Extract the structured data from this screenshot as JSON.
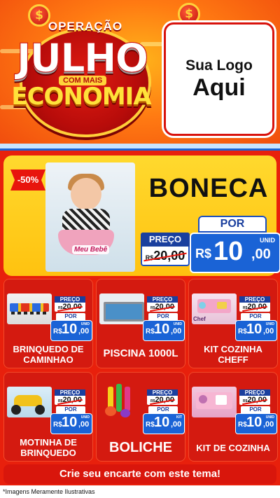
{
  "header": {
    "coin_symbol": "$",
    "title_line1": "OPERAÇÃO",
    "title_line2": "JULHO",
    "title_badge": "COM MAIS",
    "title_line3": "ECONOMIA",
    "logo_line1": "Sua Logo",
    "logo_line2": "Aqui"
  },
  "colors": {
    "background": "#e8200c",
    "price_blue": "#1a63d6",
    "label_navy": "#1a3f9e",
    "main_yellow": "#ffcf1f"
  },
  "featured": {
    "discount": "-50%",
    "name": "BONECA",
    "image_label": "Meu Bebê",
    "preco_label": "PREÇO",
    "old_currency": "R$",
    "old_price": "20,00",
    "por_label": "POR",
    "currency": "R$",
    "price_int": "10",
    "price_dec": ",00",
    "unit": "UNID"
  },
  "products": [
    {
      "name": "BRINQUEDO DE CAMINHAO",
      "preco_label": "PREÇO",
      "old_currency": "R$",
      "old_price": "20,00",
      "por_label": "POR",
      "currency": "R$",
      "price_int": "10",
      "price_dec": ",00",
      "unit": "UNID",
      "icon": "toy-trucks-icon"
    },
    {
      "name": "PISCINA 1000L",
      "preco_label": "PREÇO",
      "old_currency": "R$",
      "old_price": "20,00",
      "por_label": "POR",
      "currency": "R$",
      "price_int": "10",
      "price_dec": ",00",
      "unit": "UNID",
      "icon": "pool-icon"
    },
    {
      "name": "KIT COZINHA CHEFF",
      "preco_label": "PREÇO",
      "old_currency": "R$",
      "old_price": "20,00",
      "por_label": "POR",
      "currency": "R$",
      "price_int": "10",
      "price_dec": ",00",
      "unit": "UNID",
      "icon": "kitchen-toy-icon",
      "image_label": "Chef"
    },
    {
      "name": "MOTINHA DE BRINQUEDO",
      "preco_label": "PREÇO",
      "old_currency": "R$",
      "old_price": "20,00",
      "por_label": "POR",
      "currency": "R$",
      "price_int": "10",
      "price_dec": ",00",
      "unit": "UNID",
      "icon": "toy-motorcycle-icon"
    },
    {
      "name": "BOLICHE",
      "preco_label": "PREÇO",
      "old_currency": "R$",
      "old_price": "20,00",
      "por_label": "POR",
      "currency": "R$",
      "price_int": "10",
      "price_dec": ",00",
      "unit": "KIT",
      "icon": "bowling-pins-icon"
    },
    {
      "name": "KIT DE COZINHA",
      "preco_label": "PREÇO",
      "old_currency": "R$",
      "old_price": "20,00",
      "por_label": "POR",
      "currency": "R$",
      "price_int": "10",
      "price_dec": ",00",
      "unit": "UNID",
      "icon": "kitchen-toy-icon"
    }
  ],
  "cta": "Crie seu encarte com este tema!",
  "footer": "*Imagens Meramente Ilustrativas"
}
